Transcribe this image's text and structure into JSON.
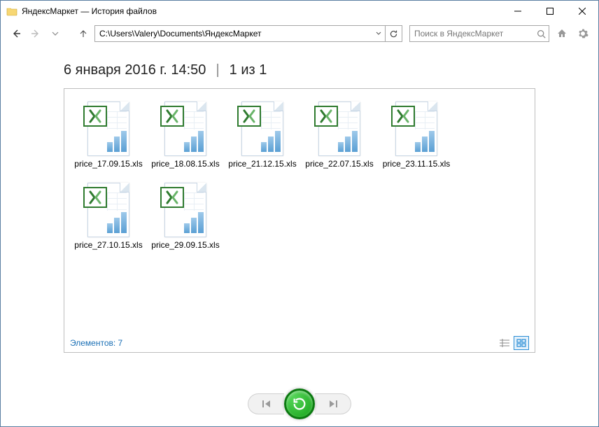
{
  "window": {
    "title": "ЯндексМаркет — История файлов"
  },
  "toolbar": {
    "path": "C:\\Users\\Valery\\Documents\\ЯндексМаркет",
    "search_placeholder": "Поиск в ЯндексМаркет"
  },
  "header": {
    "timestamp": "6 января 2016 г. 14:50",
    "pager": "1 из 1"
  },
  "files": [
    {
      "name": "price_17.09.15.xls"
    },
    {
      "name": "price_18.08.15.xls"
    },
    {
      "name": "price_21.12.15.xls"
    },
    {
      "name": "price_22.07.15.xls"
    },
    {
      "name": "price_23.11.15.xls"
    },
    {
      "name": "price_27.10.15.xls"
    },
    {
      "name": "price_29.09.15.xls"
    }
  ],
  "status": {
    "count_label": "Элементов: 7"
  }
}
